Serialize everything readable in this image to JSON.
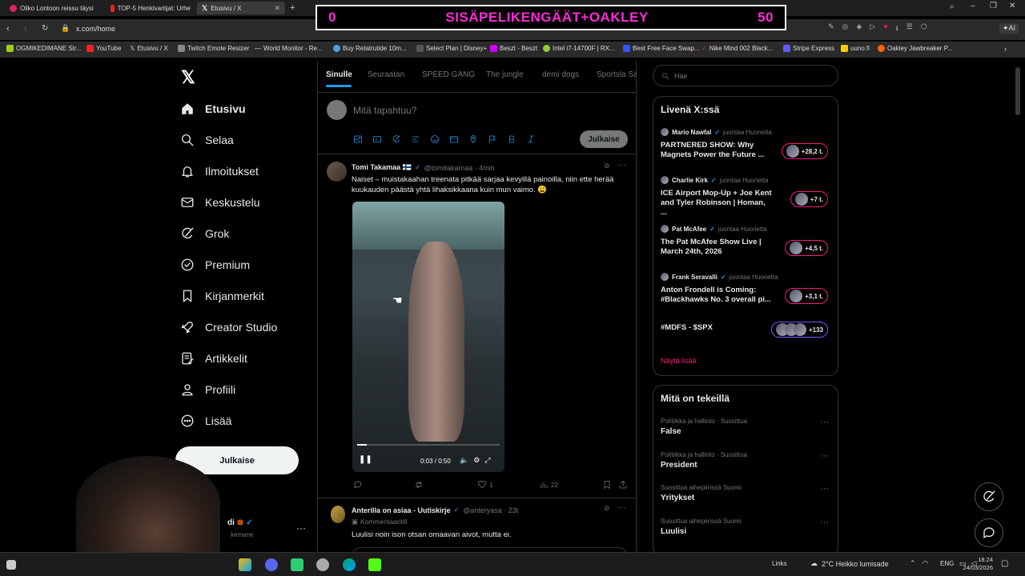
{
  "browser": {
    "tabs": [
      {
        "label": "Oliko Lontoon reissu täysi"
      },
      {
        "label": "TOP-5 Henkivartijat: Urhe"
      },
      {
        "label": "Etusivu / X"
      }
    ],
    "url": "x.com/home",
    "bookmarks": [
      "OGMIKEDIMANE Str...",
      "YouTube",
      "Etusivu / X",
      "Twitch Emote Resizer",
      "World Monitor - Re...",
      "Buy Retatrutide 10m...",
      "Select Plan | Disney+",
      "Beszt - Beszt",
      "Intel i7-14700F | RX...",
      "Best Free Face Swap...",
      "Nike Mind 002 Black...",
      "Stripe Express",
      "uuno.fi",
      "Oakley Jawbreaker P..."
    ]
  },
  "overlay": {
    "left": "0",
    "title": "SISÄPELIKENGÄÄT+OAKLEY",
    "right": "50"
  },
  "nav": {
    "items": [
      "Etusivu",
      "Selaa",
      "Ilmoitukset",
      "Keskustelu",
      "Grok",
      "Premium",
      "Kirjanmerkit",
      "Creator Studio",
      "Artikkelit",
      "Profiili",
      "Lisää"
    ],
    "post_button": "Julkaise",
    "account_fragment": "di",
    "account_sub": "kemane"
  },
  "feed": {
    "tabs": [
      "Sinulle",
      "Seuraatan",
      "SPEED GANG",
      "The jungle",
      "demi dogs",
      "Sportsla Sa"
    ],
    "composer": {
      "placeholder": "Mitä tapahtuu?",
      "post_button": "Julkaise"
    },
    "tweet1": {
      "name": "Tomi Takamaa 🇫🇮",
      "handle": "@tomitakamaa · 4min",
      "text": "Naiset – muistakaahan treenata pitkää sarjaa kevyillä painoilla, niin ette herää kuukauden päästä yhtä lihaksikkaana kuin mun vaimo. 😩",
      "video_time": "0:03 / 0:50",
      "likes": "1",
      "views": "22"
    },
    "tweet2": {
      "name": "Anterilla on asiaa - Uutiskirje",
      "handle": "@anteryasa · 23t",
      "sub": "Kommentaaritili",
      "text": "Luulisi noin ison otsan omaavan aivot, mutta ei."
    }
  },
  "search": {
    "placeholder": "Hae"
  },
  "live": {
    "title": "Livenä X:ssä",
    "items": [
      {
        "host": "Mario Nawfal",
        "status": "juontaa Huonetta",
        "title": "PARTNERED SHOW: Why Magnets Power the Future ...",
        "count": "+28,2 t."
      },
      {
        "host": "Charlie Kirk",
        "status": "juontaa Huonetta",
        "title": "ICE Airport Mop-Up + Joe Kent and Tyler Robinson | Homan, ...",
        "count": "+7 t."
      },
      {
        "host": "Pat McAfee",
        "status": "juontaa Huonetta",
        "title": "The Pat McAfee Show Live | March 24th, 2026",
        "count": "+4,5 t."
      },
      {
        "host": "Frank Seravalli",
        "status": "juontaa Huonetta",
        "title": "Anton Frondell is Coming: #Blackhawks No. 3 overall pi...",
        "count": "+3,1 t."
      },
      {
        "host": "",
        "status": "",
        "title": "#MDFS - $SPX",
        "count": "+133"
      }
    ],
    "show_more": "Näytä lisää"
  },
  "trends": {
    "title": "Mitä on tekeillä",
    "items": [
      {
        "cat": "Politiikka ja hallinto · Suosittua",
        "name": "False"
      },
      {
        "cat": "Politiikka ja hallinto · Suosittua",
        "name": "President"
      },
      {
        "cat": "Suosittua aihepiirissä Suomi",
        "name": "Yritykset"
      },
      {
        "cat": "Suosittua aihepiirissä Suomi",
        "name": "Luulisi"
      }
    ]
  },
  "taskbar": {
    "links": "Links",
    "weather": "2°C Heikko lumisade",
    "lang": "ENG",
    "time": "18.24",
    "date": "24/03/2026"
  }
}
